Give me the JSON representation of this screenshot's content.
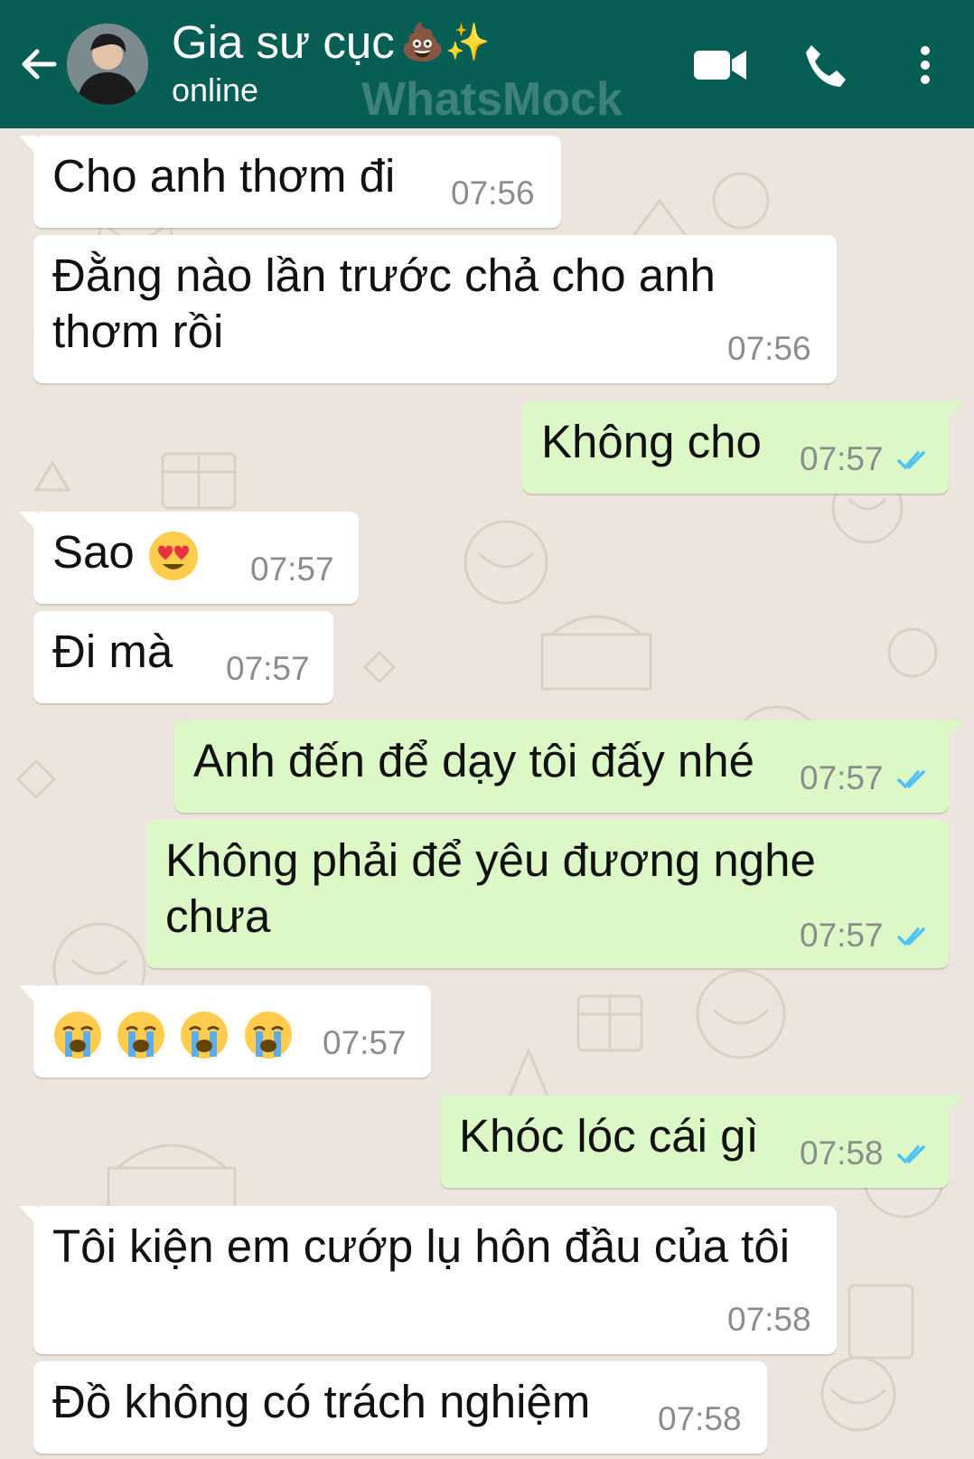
{
  "header": {
    "contact_name": "Gia sư cục",
    "title_emoji": "💩✨",
    "status": "online",
    "watermark": "WhatsMock",
    "colors": {
      "bar": "#075e54",
      "incoming": "#ffffff",
      "outgoing": "#dcf8c6",
      "read_ticks": "#4fc3f7",
      "background": "#ece5dd"
    },
    "icons": [
      "back-arrow-icon",
      "avatar",
      "video-call-icon",
      "phone-icon",
      "more-vert-icon"
    ]
  },
  "messages": [
    {
      "dir": "in",
      "text": "Cho anh thơm đi",
      "time": "07:56"
    },
    {
      "dir": "in",
      "text_line1": "Đằng nào lần trước chả cho anh",
      "text_line2": "thơm rồi",
      "time": "07:56"
    },
    {
      "dir": "out",
      "text": "Không cho",
      "time": "07:57",
      "status": "read"
    },
    {
      "dir": "in",
      "text": "Sao",
      "emoji": "😍",
      "time": "07:57"
    },
    {
      "dir": "in",
      "text": "Đi mà",
      "time": "07:57"
    },
    {
      "dir": "out",
      "text": "Anh đến để dạy tôi đấy nhé",
      "time": "07:57",
      "status": "read"
    },
    {
      "dir": "out",
      "text_line1": "Không phải để yêu đương nghe",
      "text_line2": "chưa",
      "time": "07:57",
      "status": "read"
    },
    {
      "dir": "in",
      "emoji": "😭😭😭😭",
      "time": "07:57"
    },
    {
      "dir": "out",
      "text": "Khóc lóc cái gì",
      "time": "07:58",
      "status": "read"
    },
    {
      "dir": "in",
      "text": "Tôi kiện em cướp lụ hôn đầu của tôi",
      "time": "07:58"
    },
    {
      "dir": "in",
      "text": "Đồ không có trách nghiệm",
      "time": "07:58"
    }
  ]
}
